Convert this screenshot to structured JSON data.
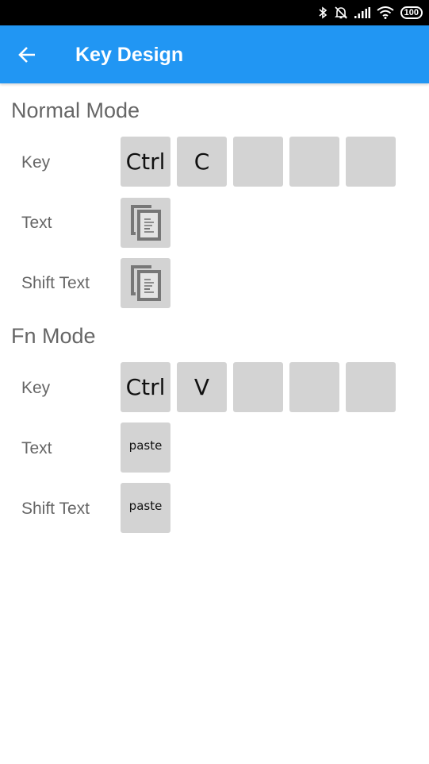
{
  "status_bar": {
    "icons": [
      "bluetooth-icon",
      "notifications-off-icon",
      "signal-icon",
      "wifi-icon"
    ],
    "battery": "100"
  },
  "app_bar": {
    "back_icon": "arrow-left-icon",
    "title": "Key Design",
    "color": "#2196f3"
  },
  "sections": [
    {
      "title": "Normal Mode",
      "rows": {
        "key": {
          "label": "Key",
          "keys": [
            "Ctrl",
            "C",
            "",
            "",
            ""
          ]
        },
        "text": {
          "label": "Text",
          "value_icon": "content-copy-icon"
        },
        "shift_text": {
          "label": "Shift Text",
          "value_icon": "content-copy-icon"
        }
      }
    },
    {
      "title": "Fn Mode",
      "rows": {
        "key": {
          "label": "Key",
          "keys": [
            "Ctrl",
            "V",
            "",
            "",
            ""
          ]
        },
        "text": {
          "label": "Text",
          "value": "paste"
        },
        "shift_text": {
          "label": "Shift Text",
          "value": "paste"
        }
      }
    }
  ]
}
